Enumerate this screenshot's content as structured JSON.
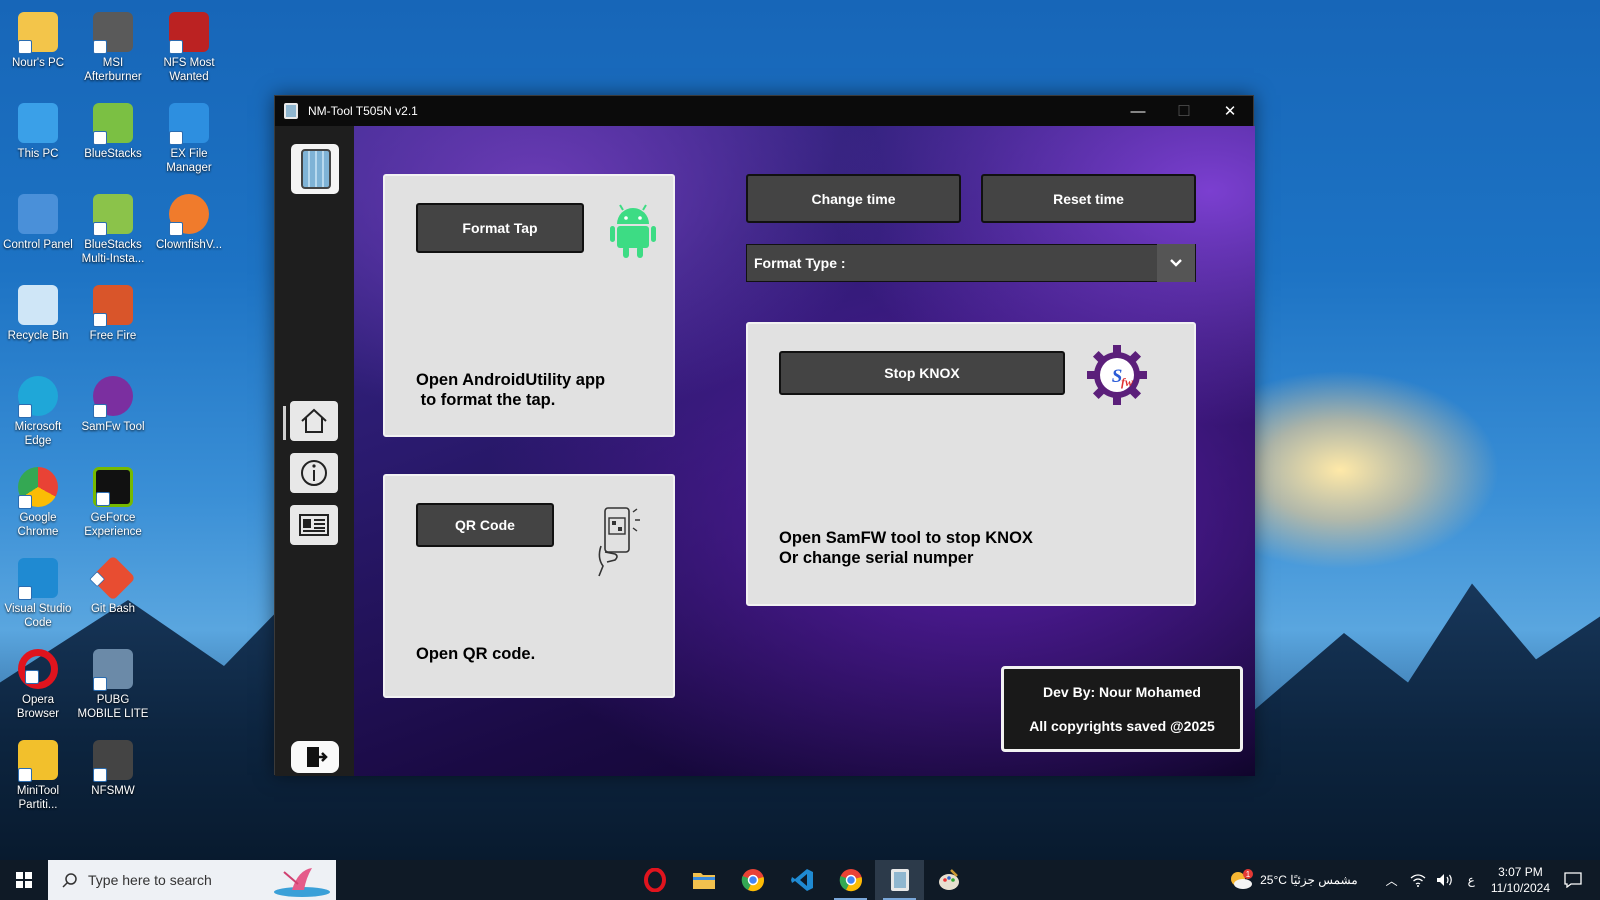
{
  "desktop": {
    "icons": [
      {
        "label": "Nour's PC",
        "color": "#f3c54a"
      },
      {
        "label": "MSI Afterburner",
        "color": "#5a5a5a"
      },
      {
        "label": "NFS Most Wanted",
        "color": "#b22"
      },
      {
        "label": "This PC",
        "color": "#3aa0e8"
      },
      {
        "label": "BlueStacks",
        "color": "#7bc043"
      },
      {
        "label": "EX File Manager",
        "color": "#2d8fe0"
      },
      {
        "label": "Control Panel",
        "color": "#4a90d9"
      },
      {
        "label": "BlueStacks Multi-Insta...",
        "color": "#8bc34a"
      },
      {
        "label": "ClownfishV...",
        "color": "#f07b2c"
      },
      {
        "label": "Recycle Bin",
        "color": "#cfe6f7"
      },
      {
        "label": "Free Fire",
        "color": "#d9552a"
      },
      {
        "label": "Microsoft Edge",
        "color": "#1fa7d8"
      },
      {
        "label": "SamFw Tool",
        "color": "#7b2fa0"
      },
      {
        "label": "Google Chrome",
        "color": "#e94235"
      },
      {
        "label": "GeForce Experience",
        "color": "#76b900"
      },
      {
        "label": "Visual Studio Code",
        "color": "#1f8ad2"
      },
      {
        "label": "Git Bash",
        "color": "#e84d31"
      },
      {
        "label": "Opera Browser",
        "color": "#e0141e"
      },
      {
        "label": "PUBG MOBILE LITE",
        "color": "#6b8aa8"
      },
      {
        "label": "MiniTool Partiti...",
        "color": "#f2c02c"
      },
      {
        "label": "NFSMW",
        "color": "#444"
      }
    ]
  },
  "window": {
    "title": "NM-Tool T505N  v2.1",
    "minimize": "—",
    "maximize": "☐",
    "close": "✕"
  },
  "sidebar": {
    "items": [
      {
        "name": "home",
        "icon": "home-icon"
      },
      {
        "name": "info",
        "icon": "info-icon"
      },
      {
        "name": "contact",
        "icon": "id-card-icon"
      }
    ],
    "exit_icon": "exit-icon"
  },
  "main": {
    "format_card": {
      "button": "Format Tap",
      "text": "Open AndroidUtility app\n to format the tap.",
      "icon": "android-icon"
    },
    "qr_card": {
      "button": "QR Code",
      "text": "Open QR code.",
      "icon": "qr-phone-icon"
    },
    "change_time": "Change time",
    "reset_time": "Reset time",
    "format_type": {
      "label": "Format Type :",
      "icon": "chevron-down-icon"
    },
    "knox_card": {
      "button": "Stop KNOX",
      "text": "Open SamFW tool to stop KNOX\nOr change serial numper",
      "icon": "samfw-icon"
    },
    "dev": {
      "line1": "Dev By: Nour Mohamed",
      "line2": "All copyrights saved @2025"
    }
  },
  "taskbar": {
    "search_placeholder": "Type here to search",
    "weather": "25°C  مشمس جزئيًا",
    "lang": "ع",
    "time": "3:07 PM",
    "date": "11/10/2024",
    "notification_badge": "1"
  },
  "colors": {
    "accent_purple": "#5a1fa8",
    "button_dark": "#444444",
    "card_bg": "#e1e1e1"
  }
}
